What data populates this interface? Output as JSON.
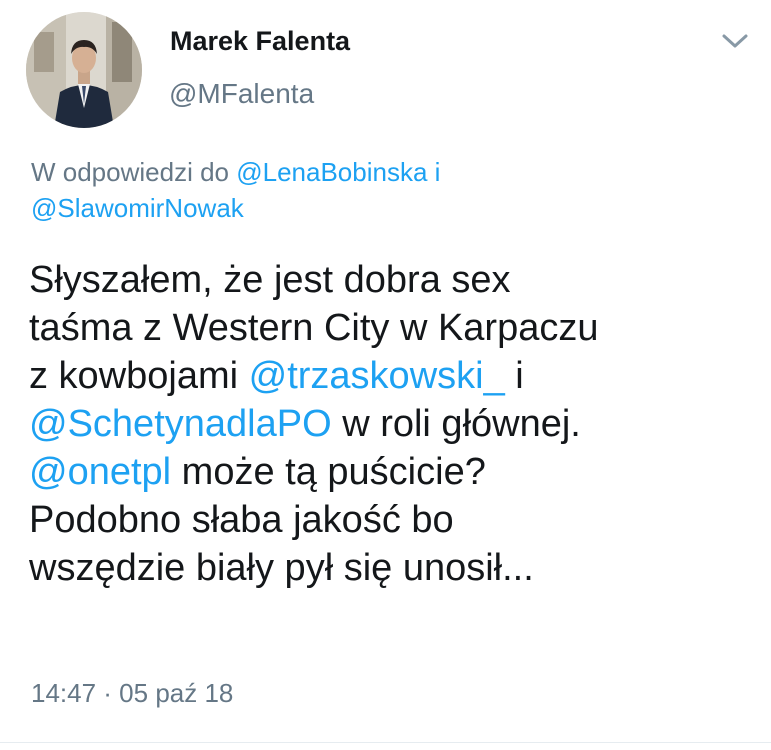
{
  "author": {
    "name": "Marek Falenta",
    "handle": "@MFalenta"
  },
  "reply_context": {
    "prefix": "W odpowiedzi do ",
    "mention_1": "@LenaBobinska",
    "conjunction": " i",
    "mention_2": "@SlawomirNowak"
  },
  "tweet": {
    "line_1": "Słyszałem, że jest dobra sex",
    "line_2": "taśma z Western City w Karpaczu",
    "line_3_text": "z kowbojami ",
    "line_3_mention": "@trzaskowski_",
    "line_3_end": " i",
    "line_4_mention": "@SchetynadlaPO",
    "line_4_text": " w roli głównej.",
    "line_5_mention": "@onetpl",
    "line_5_text": " może tą puścicie?",
    "line_6": "Podobno słaba jakość bo",
    "line_7": "wszędzie biały pył się unosił..."
  },
  "timestamp": "14:47 · 05 paź 18",
  "colors": {
    "link": "#1da1f2",
    "secondary_text": "#657786",
    "primary_text": "#14171a"
  },
  "icons": {
    "menu": "chevron-down-icon",
    "avatar": "profile-photo"
  }
}
